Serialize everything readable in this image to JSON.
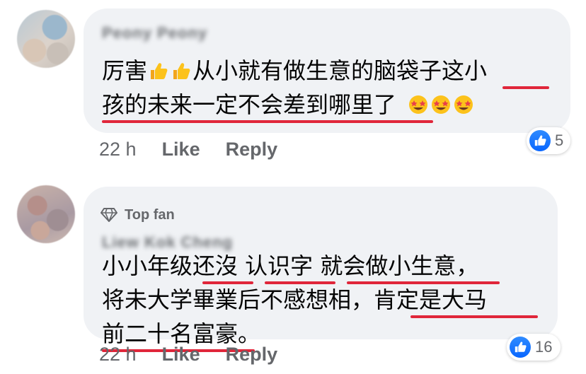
{
  "comments": [
    {
      "author": "Peony Peony",
      "lines": [
        "厉害",
        "从小就有做生意的脑袋子这小",
        "孩的未来一定不会差到哪里了"
      ],
      "time": "22 h",
      "like_label": "Like",
      "reply_label": "Reply",
      "reaction_count": "5",
      "emoji": [
        "thumbs-up",
        "star-struck"
      ]
    },
    {
      "badge": "Top fan",
      "author": "Liew Kok Cheng",
      "lines": [
        "小小年级还沒 认识字 就会做小生意，",
        "将未大学畢業后不感想相，肯定是大马",
        "前二十名富豪。"
      ],
      "time": "22 h",
      "like_label": "Like",
      "reply_label": "Reply",
      "reaction_count": "16"
    }
  ],
  "colors": {
    "underline": "#e0263a",
    "bubble": "#f0f2f5",
    "like_blue": "#0866ff",
    "meta": "#65676b"
  },
  "icons": [
    "thumbs-up-emoji",
    "star-struck-emoji",
    "diamond-icon",
    "like-icon"
  ]
}
